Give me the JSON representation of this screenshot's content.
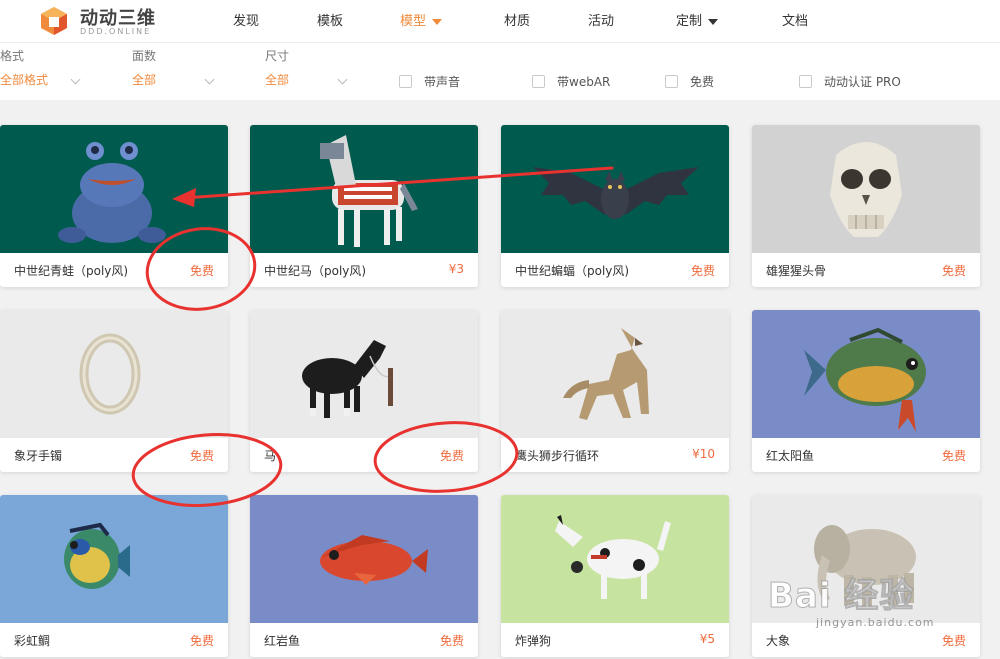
{
  "header": {
    "logo_text": "动动三维",
    "logo_sub": "DDD.ONLINE",
    "nav": [
      {
        "label": "发现"
      },
      {
        "label": "模板"
      },
      {
        "label": "模型"
      },
      {
        "label": "材质"
      },
      {
        "label": "活动"
      },
      {
        "label": "定制"
      },
      {
        "label": "文档"
      }
    ],
    "active_nav": "模型",
    "accent_color": "#f08a3c"
  },
  "filters": {
    "format": {
      "label": "格式",
      "value": "全部格式"
    },
    "faces": {
      "label": "面数",
      "value": "全部"
    },
    "size": {
      "label": "尺寸",
      "value": "全部"
    },
    "checkboxes": [
      {
        "label": "带声音",
        "checked": false
      },
      {
        "label": "带webAR",
        "checked": false
      },
      {
        "label": "免费",
        "checked": false
      },
      {
        "label": "动动认证 PRO",
        "checked": false
      }
    ]
  },
  "cards": [
    {
      "title": "中世纪青蛙（poly风)",
      "price": "免费",
      "thumb": "frog",
      "bg": "#005a4e"
    },
    {
      "title": "中世纪马（poly风)",
      "price": "¥3",
      "thumb": "horse-armored",
      "bg": "#005a4e"
    },
    {
      "title": "中世纪蝙蝠（poly风)",
      "price": "免费",
      "thumb": "bat",
      "bg": "#005a4e"
    },
    {
      "title": "雄猩猩头骨",
      "price": "免费",
      "thumb": "skull",
      "bg": "#d2d2d2"
    },
    {
      "title": "象牙手镯",
      "price": "免费",
      "thumb": "bracelet",
      "bg": "#eaeaea"
    },
    {
      "title": "马",
      "price": "免费",
      "thumb": "horse",
      "bg": "#eaeaea"
    },
    {
      "title": "鹰头狮步行循环",
      "price": "¥10",
      "thumb": "griffin",
      "bg": "#eaeaea"
    },
    {
      "title": "红太阳鱼",
      "price": "免费",
      "thumb": "sunfish",
      "bg": "#7a8cc8"
    },
    {
      "title": "彩虹鲷",
      "price": "免费",
      "thumb": "rainbow-fish",
      "bg": "#7aa7d8"
    },
    {
      "title": "红岩鱼",
      "price": "免费",
      "thumb": "red-fish",
      "bg": "#7a8cc8"
    },
    {
      "title": "炸弹狗",
      "price": "¥5",
      "thumb": "dog",
      "bg": "#c6e3a0"
    },
    {
      "title": "大象",
      "price": "免费",
      "thumb": "elephant",
      "bg": "#eaeaea"
    }
  ],
  "annotation_color": "#e8322f",
  "watermark": {
    "text": "Bai 经验",
    "url": "jingyan.baidu.com"
  }
}
